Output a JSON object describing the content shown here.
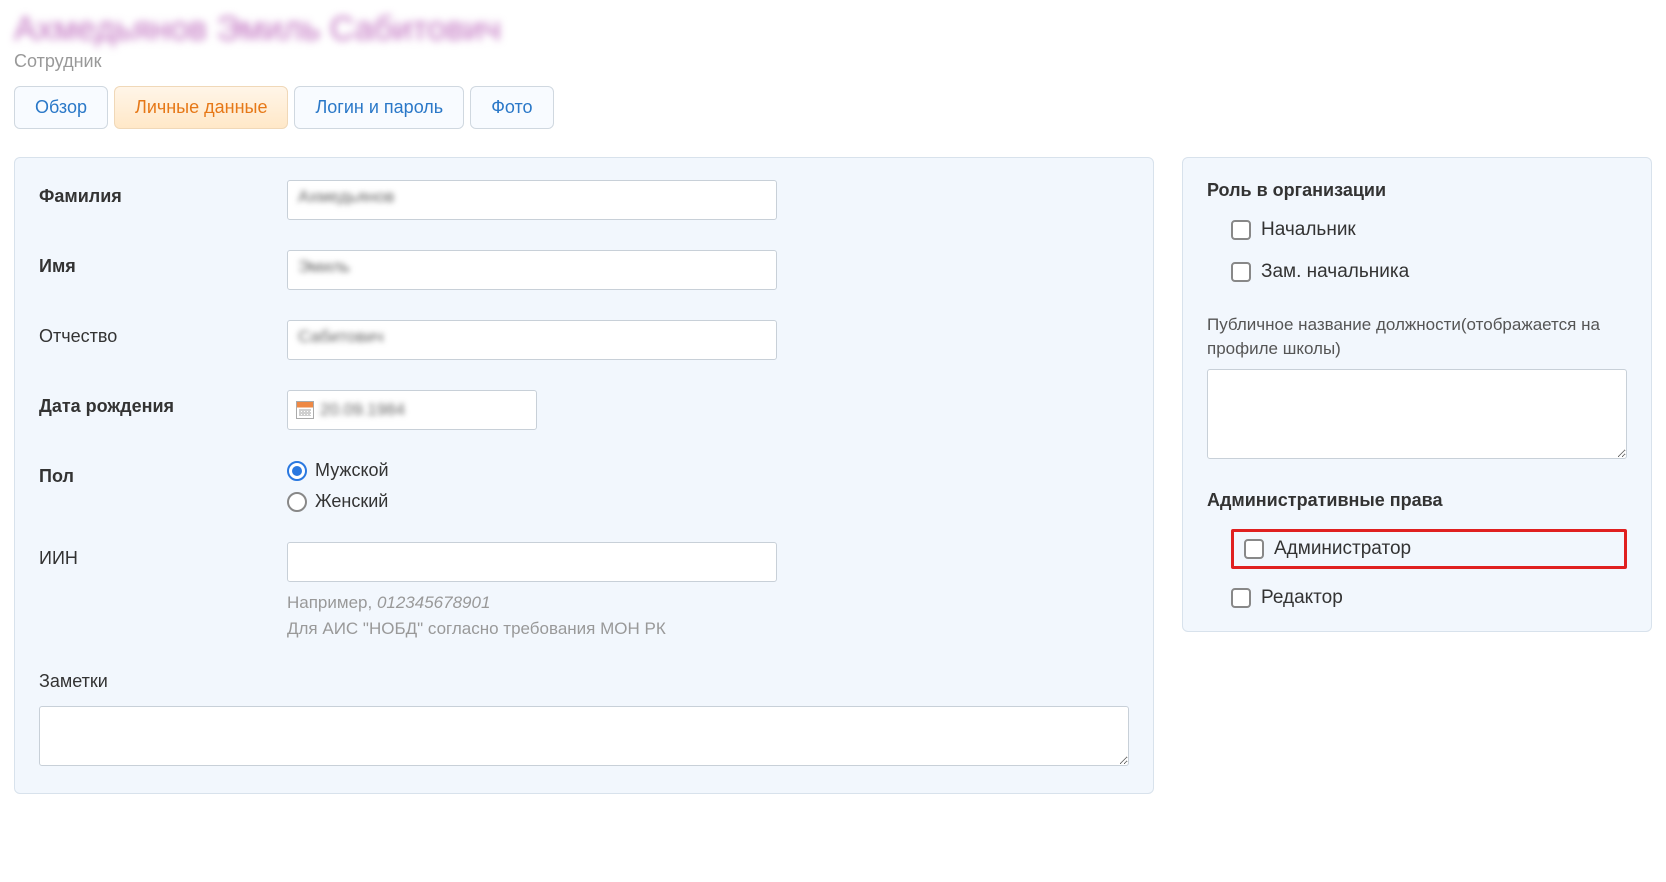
{
  "header": {
    "title": "Ахмедьянов Эмиль Сабитович",
    "subtitle": "Сотрудник"
  },
  "tabs": [
    {
      "label": "Обзор",
      "active": false
    },
    {
      "label": "Личные данные",
      "active": true
    },
    {
      "label": "Логин и пароль",
      "active": false
    },
    {
      "label": "Фото",
      "active": false
    }
  ],
  "form": {
    "lastname_label": "Фамилия",
    "lastname_value": "Ахмедьянов",
    "firstname_label": "Имя",
    "firstname_value": "Эмиль",
    "patronymic_label": "Отчество",
    "patronymic_value": "Сабитович",
    "birthdate_label": "Дата рождения",
    "birthdate_value": "20.09.1984",
    "gender_label": "Пол",
    "gender_options": {
      "male": "Мужской",
      "female": "Женский"
    },
    "gender_selected": "male",
    "iin_label": "ИИН",
    "iin_value": "",
    "iin_hint_prefix": "Например, ",
    "iin_hint_example": "012345678901",
    "iin_hint_line2": "Для АИС \"НОБД\" согласно требования МОН РК",
    "notes_label": "Заметки",
    "notes_value": ""
  },
  "sidebar": {
    "role_title": "Роль в организации",
    "roles": [
      {
        "label": "Начальник",
        "checked": false
      },
      {
        "label": "Зам. начальника",
        "checked": false
      }
    ],
    "public_title_label": "Публичное название должности(отображается на профиле школы)",
    "public_title_value": "",
    "rights_title": "Административные права",
    "rights": [
      {
        "label": "Администратор",
        "checked": false,
        "highlighted": true
      },
      {
        "label": "Редактор",
        "checked": false,
        "highlighted": false
      }
    ]
  }
}
